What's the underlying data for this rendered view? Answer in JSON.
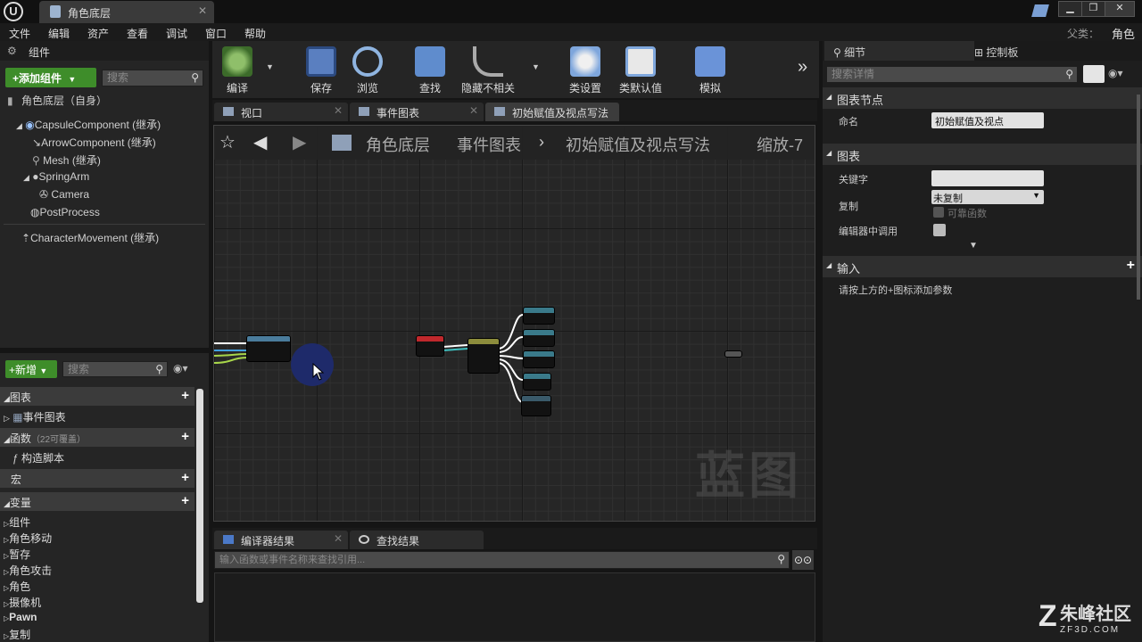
{
  "window": {
    "tab_title": "角色底层",
    "logo": "U",
    "min": "▁",
    "max": "❐",
    "close": "✕"
  },
  "menu": [
    "文件",
    "编辑",
    "资产",
    "查看",
    "调试",
    "窗口",
    "帮助"
  ],
  "parent_class": {
    "label": "父类：",
    "value": "角色"
  },
  "components": {
    "title": "组件",
    "add_button": "+添加组件",
    "search_placeholder": "搜索",
    "self_label": "角色底层（自身）",
    "items": [
      "CapsuleComponent (继承)",
      "ArrowComponent (继承)",
      "Mesh (继承)",
      "SpringArm",
      "Camera",
      "PostProcess",
      "CharacterMovement (继承)"
    ]
  },
  "my_blueprint": {
    "new_button": "+新增",
    "search_placeholder": "搜索",
    "sections": {
      "graphs": "图表",
      "event_graph": "事件图表",
      "functions": "函数",
      "functions_note": "（22可覆盖）",
      "construction_script": "构造脚本",
      "macros": "宏",
      "variables": "变量"
    },
    "variable_categories": [
      "组件",
      "角色移动",
      "暂存",
      "角色攻击",
      "角色",
      "摄像机",
      "Pawn",
      "复制"
    ]
  },
  "toolbar": [
    {
      "label": "编译",
      "icon": "compile-icon"
    },
    {
      "label": "保存",
      "icon": "save-icon"
    },
    {
      "label": "浏览",
      "icon": "browse-icon"
    },
    {
      "label": "查找",
      "icon": "find-icon"
    },
    {
      "label": "隐藏不相关",
      "icon": "hide-unrelated-icon"
    },
    {
      "label": "类设置",
      "icon": "class-settings-icon"
    },
    {
      "label": "类默认值",
      "icon": "class-defaults-icon"
    },
    {
      "label": "模拟",
      "icon": "simulate-icon"
    }
  ],
  "editor_tabs": [
    "视口",
    "事件图表",
    "初始赋值及视点写法"
  ],
  "graph": {
    "breadcrumb": [
      "角色底层",
      "事件图表",
      "初始赋值及视点写法"
    ],
    "zoom": "缩放-7",
    "watermark": "蓝图"
  },
  "results": {
    "tabs": [
      "编译器结果",
      "查找结果"
    ],
    "search_placeholder": "输入函数或事件名称来查找引用..."
  },
  "details": {
    "tabs": [
      "细节",
      "控制板"
    ],
    "search_placeholder": "搜索详情",
    "graph_node_header": "图表节点",
    "name_label": "命名",
    "name_value": "初始赋值及视点",
    "graph_header": "图表",
    "keyword_label": "关键字",
    "replicate_label": "复制",
    "replicate_value": "未复制",
    "reliable_label": "可靠函数",
    "call_in_editor_label": "编辑器中调用",
    "inputs_header": "输入",
    "inputs_hint": "请按上方的+图标添加参数"
  },
  "watermark_logo": {
    "name": "朱峰社区",
    "domain": "ZF3D.COM"
  }
}
